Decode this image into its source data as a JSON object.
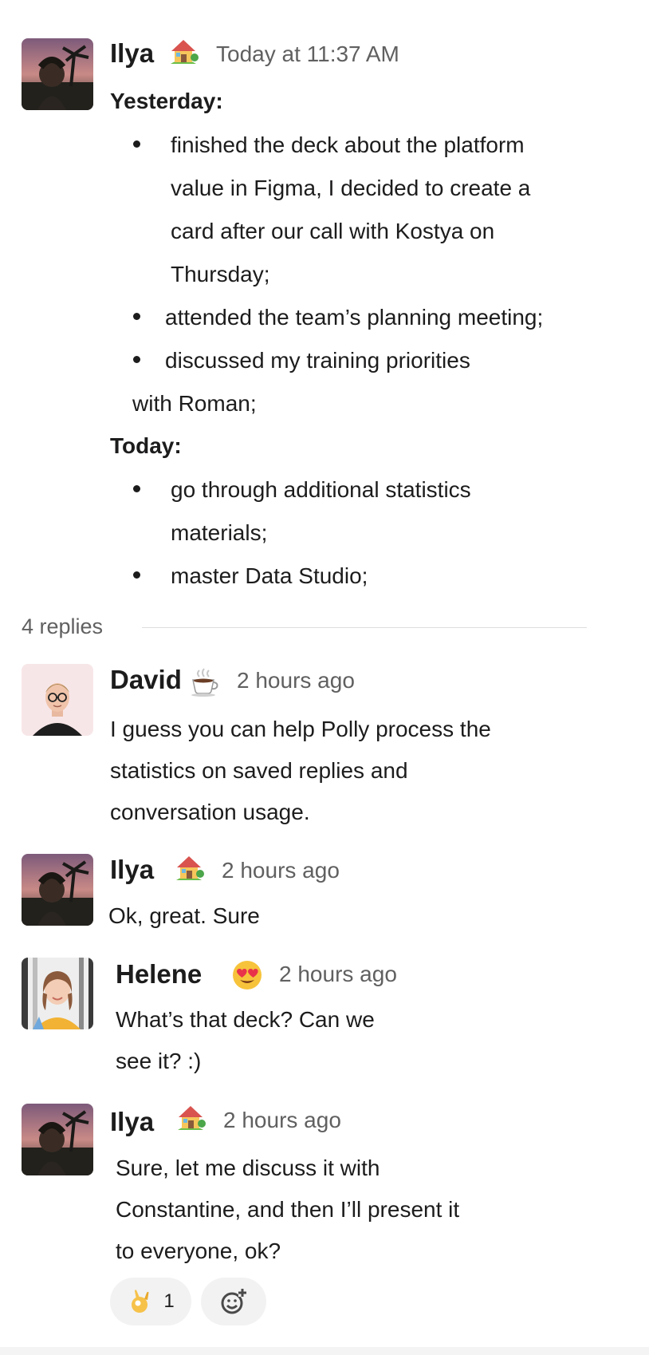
{
  "thread": {
    "replies_label": "4 replies"
  },
  "messages": [
    {
      "author": "Ilya",
      "status_emoji": "house-with-garden-icon",
      "time": "Today at 11:37 AM",
      "sections": [
        {
          "heading": "Yesterday:",
          "bullets": [
            [
              "finished the deck about the platform",
              "value in Figma, I decided to create a",
              "card after our call with Kostya on",
              "Thursday;"
            ],
            [
              "attended the team’s planning meeting;"
            ],
            [
              "discussed my training priorities",
              "with Roman;"
            ]
          ]
        },
        {
          "heading": "Today:",
          "bullets": [
            [
              "go through additional statistics",
              "materials;"
            ],
            [
              "master Data Studio;"
            ]
          ]
        }
      ]
    },
    {
      "author": "David",
      "status_emoji": "hot-beverage-icon",
      "time": "2 hours ago",
      "lines": [
        "I guess you can help Polly process the",
        "statistics on saved replies and",
        "conversation usage."
      ]
    },
    {
      "author": "Ilya",
      "status_emoji": "house-with-garden-icon",
      "time": "2 hours ago",
      "lines": [
        "Ok, great. Sure"
      ]
    },
    {
      "author": "Helene",
      "status_emoji": "heart-eyes-face-icon",
      "time": "2 hours ago",
      "lines": [
        "What’s that deck? Can we",
        "see it? :)"
      ]
    },
    {
      "author": "Ilya",
      "status_emoji": "house-with-garden-icon",
      "time": "2 hours ago",
      "lines": [
        "Sure, let me discuss it with",
        "Constantine, and then I’ll present it",
        "to everyone, ok?"
      ],
      "reactions": [
        {
          "emoji": "ok-hand-icon",
          "count": "1"
        }
      ],
      "add_reaction": "add-reaction-icon"
    }
  ]
}
